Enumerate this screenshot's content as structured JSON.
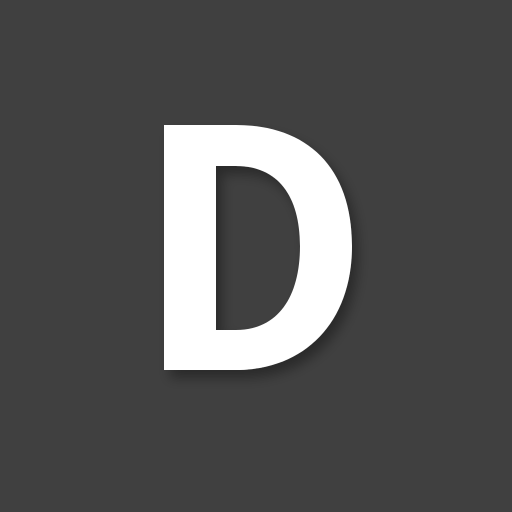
{
  "icon": {
    "letter": "D",
    "name": "letter-d-icon"
  },
  "colors": {
    "background": "#404040",
    "foreground": "#ffffff",
    "shadow": "#000000"
  }
}
